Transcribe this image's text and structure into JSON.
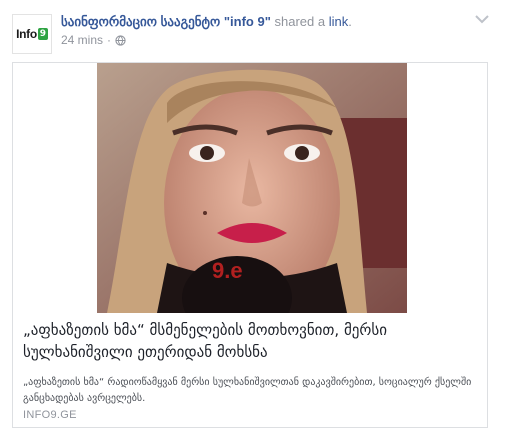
{
  "post": {
    "page_name": "საინფორმაციო სააგენტო \"info 9\"",
    "shared_text": " shared a ",
    "link_text": "link",
    "period": ".",
    "timestamp": "24 mins",
    "separator": "·",
    "avatar_text": "Info",
    "avatar_badge": "9",
    "privacy_icon": "globe-icon",
    "menu_icon": "chevron-down-icon"
  },
  "card": {
    "title": "„აფხაზეთის ხმა“ მსმენელების მოთხოვნით, მერსი სულხანიშვილი ეთერიდან მოხსნა",
    "description": "„აფხაზეთის ხმა“ რადიოწამყვან მერსი სულხანიშვილთან დაკავშირებით, სოციალურ ქსელში განცხადებას ავრცელებს.",
    "domain": "INFO9.GE",
    "image_text": "9.e"
  },
  "colors": {
    "link": "#365899",
    "meta": "#90949c",
    "badge": "#2ea343",
    "border": "#dddfe2"
  }
}
